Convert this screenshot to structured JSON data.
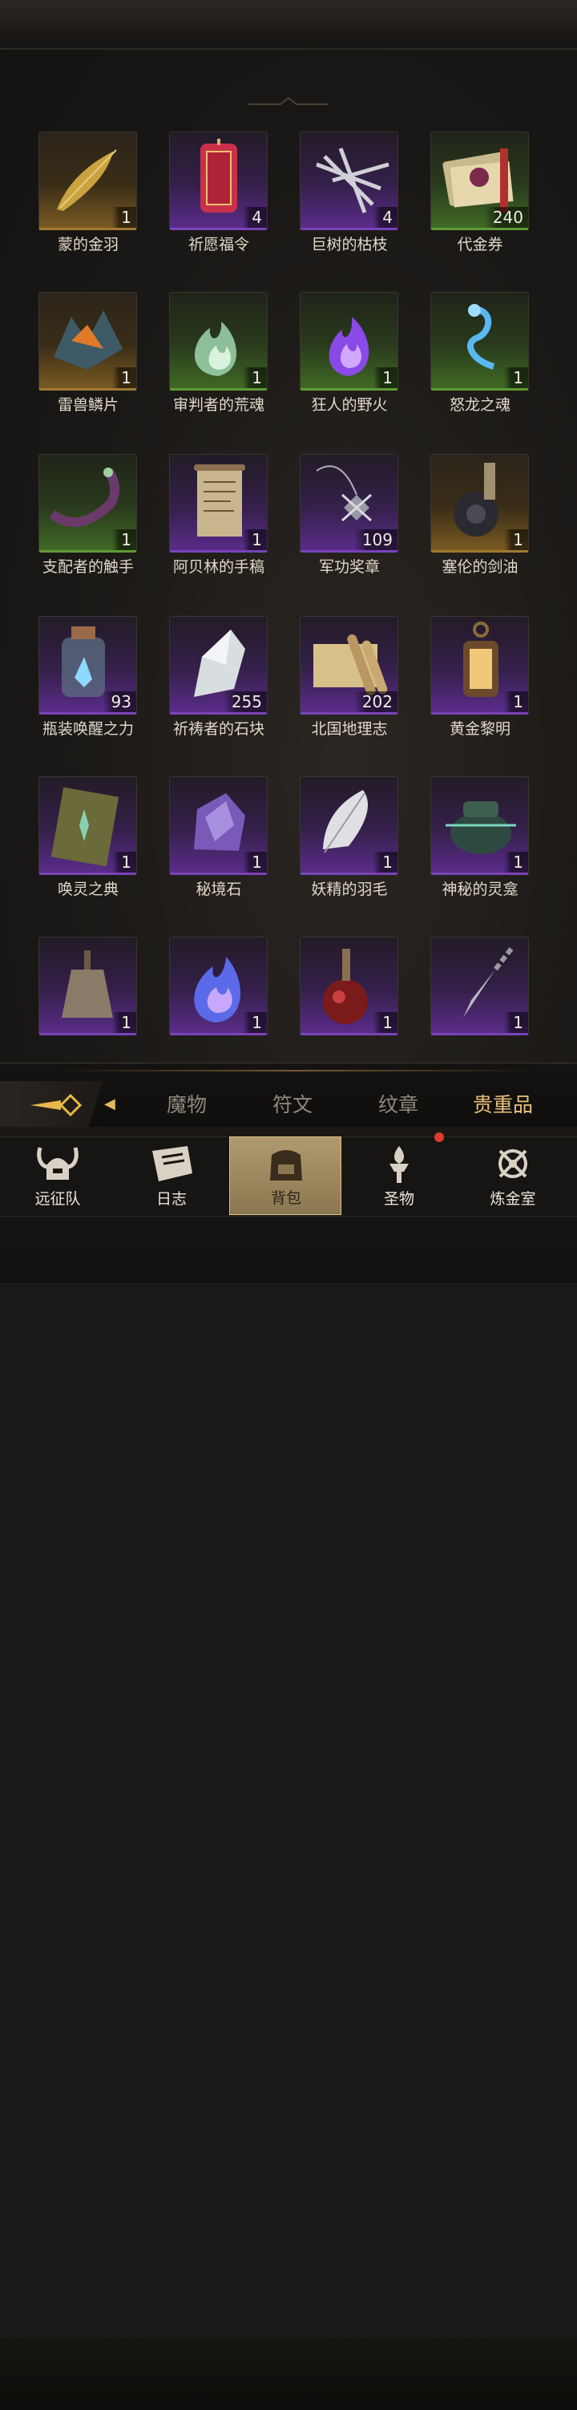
{
  "items": [
    {
      "name": "蒙的金羽",
      "count": "1",
      "rarity": "gold",
      "icon": "golden-feather-icon"
    },
    {
      "name": "祈愿福令",
      "count": "4",
      "rarity": "purple",
      "icon": "red-talisman-icon"
    },
    {
      "name": "巨树的枯枝",
      "count": "4",
      "rarity": "purple",
      "icon": "dry-branches-icon"
    },
    {
      "name": "代金券",
      "count": "240",
      "rarity": "green",
      "icon": "voucher-stack-icon"
    },
    {
      "name": "雷兽鳞片",
      "count": "1",
      "rarity": "gold",
      "icon": "scale-crystal-icon"
    },
    {
      "name": "审判者的荒魂",
      "count": "1",
      "rarity": "green",
      "icon": "green-flame-icon"
    },
    {
      "name": "狂人的野火",
      "count": "1",
      "rarity": "green",
      "icon": "purple-flame-icon"
    },
    {
      "name": "怒龙之魂",
      "count": "1",
      "rarity": "green",
      "icon": "blue-spirit-icon"
    },
    {
      "name": "支配者的触手",
      "count": "1",
      "rarity": "green",
      "icon": "tentacle-icon"
    },
    {
      "name": "阿贝林的手稿",
      "count": "1",
      "rarity": "purple",
      "icon": "scroll-manuscript-icon"
    },
    {
      "name": "军功奖章",
      "count": "109",
      "rarity": "purple",
      "icon": "medal-pendant-icon"
    },
    {
      "name": "塞伦的剑油",
      "count": "1",
      "rarity": "gold",
      "icon": "oil-flask-icon"
    },
    {
      "name": "瓶装唤醒之力",
      "count": "93",
      "rarity": "purple",
      "icon": "crystal-bottle-icon"
    },
    {
      "name": "祈祷者的石块",
      "count": "255",
      "rarity": "purple",
      "icon": "white-stone-icon"
    },
    {
      "name": "北国地理志",
      "count": "202",
      "rarity": "purple",
      "icon": "map-scrolls-icon"
    },
    {
      "name": "黄金黎明",
      "count": "1",
      "rarity": "purple",
      "icon": "lantern-icon"
    },
    {
      "name": "唤灵之典",
      "count": "1",
      "rarity": "purple",
      "icon": "spell-book-icon"
    },
    {
      "name": "秘境石",
      "count": "1",
      "rarity": "purple",
      "icon": "amethyst-stone-icon"
    },
    {
      "name": "妖精的羽毛",
      "count": "1",
      "rarity": "purple",
      "icon": "white-feather-icon"
    },
    {
      "name": "神秘的灵龛",
      "count": "1",
      "rarity": "purple",
      "icon": "censer-icon"
    },
    {
      "name": "",
      "count": "1",
      "rarity": "purple",
      "icon": "bell-icon"
    },
    {
      "name": "",
      "count": "1",
      "rarity": "purple",
      "icon": "blue-flame-icon"
    },
    {
      "name": "",
      "count": "1",
      "rarity": "purple",
      "icon": "red-potion-icon"
    },
    {
      "name": "",
      "count": "1",
      "rarity": "purple",
      "icon": "chain-dagger-icon"
    }
  ],
  "tabs": [
    "魔物",
    "符文",
    "纹章",
    "贵重品"
  ],
  "active_tab": "贵重品",
  "nav": [
    {
      "label": "远征队",
      "icon": "horned-helmet-icon"
    },
    {
      "label": "日志",
      "icon": "journal-icon"
    },
    {
      "label": "背包",
      "icon": "backpack-icon"
    },
    {
      "label": "圣物",
      "icon": "torch-icon"
    },
    {
      "label": "炼金室",
      "icon": "alchemy-icon"
    }
  ],
  "active_nav": "背包",
  "colors": {
    "gold": "#a07a32",
    "purple": "#7a43b8",
    "green": "#5f9a34",
    "active_tab": "#e8c27a",
    "notification": "#e23a2f"
  }
}
